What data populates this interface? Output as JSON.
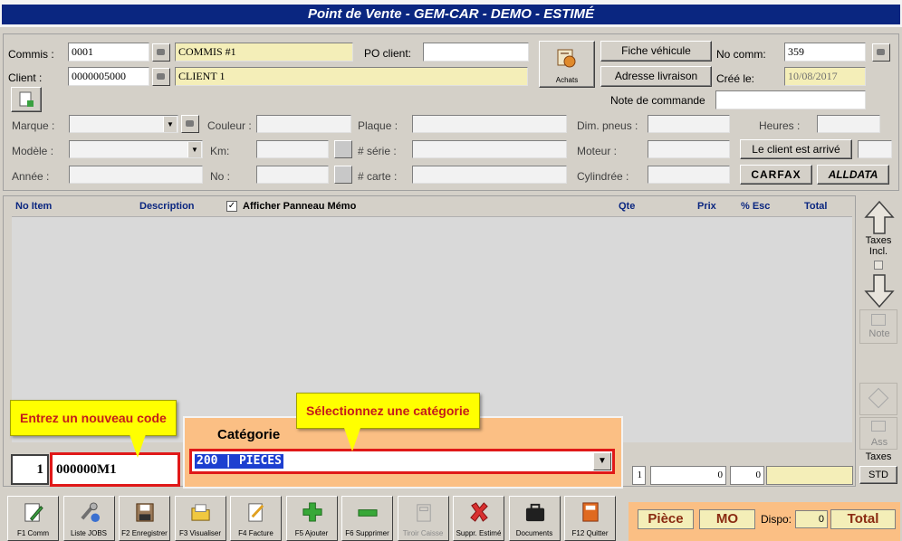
{
  "window": {
    "title": "Point de Vente - GEM-CAR - DEMO - ESTIMÉ"
  },
  "header": {
    "commis_label": "Commis :",
    "commis_code": "0001",
    "commis_name": "COMMIS #1",
    "client_label": "Client :",
    "client_code": "0000005000",
    "client_name": "CLIENT 1",
    "po_label": "PO client:",
    "po_value": "",
    "achats_label": "Achats",
    "fiche_vehicule": "Fiche véhicule",
    "adresse_livraison": "Adresse livraison",
    "no_comm_label": "No comm:",
    "no_comm_value": "359",
    "cree_le_label": "Créé le:",
    "cree_le_value": "10/08/2017",
    "note_commande_label": "Note de commande",
    "note_commande_value": ""
  },
  "vehicle": {
    "marque_label": "Marque :",
    "couleur_label": "Couleur :",
    "plaque_label": "Plaque :",
    "dim_pneus_label": "Dim. pneus :",
    "heures_label": "Heures :",
    "modele_label": "Modèle :",
    "km_label": "Km:",
    "serie_label": "# série :",
    "moteur_label": "Moteur :",
    "client_arrive": "Le client est arrivé",
    "annee_label": "Année :",
    "no_label": "No :",
    "carte_label": "# carte :",
    "cylindree_label": "Cylindrée :",
    "carfax_logo": "CARFAX",
    "alldata_logo": "ALLDATA"
  },
  "grid": {
    "col_no_item": "No Item",
    "col_description": "Description",
    "memo_checkbox_label": "Afficher Panneau Mémo",
    "memo_checked": true,
    "col_qte": "Qte",
    "col_prix": "Prix",
    "col_esc": "% Esc",
    "col_total": "Total"
  },
  "sidebar": {
    "taxes_incl_label": "Taxes Incl.",
    "note_label": "Note",
    "ass_label": "Ass",
    "taxes_label": "Taxes",
    "std_label": "STD"
  },
  "entry": {
    "qty": "1",
    "code": "000000M1",
    "categorie_label": "Catégorie",
    "categorie_value": "200 | PIECES"
  },
  "callouts": {
    "code": "Entrez un nouveau code",
    "categorie": "Sélectionnez une catégorie"
  },
  "totals_row": {
    "qty": "1",
    "v1": "0",
    "v2": "0"
  },
  "toolbar": [
    {
      "label": "F1 Comm",
      "icon": "pen-icon",
      "enabled": true
    },
    {
      "label": "Liste JOBS",
      "icon": "tools-icon",
      "enabled": true
    },
    {
      "label": "F2 Enregistrer",
      "icon": "floppy-icon",
      "enabled": true
    },
    {
      "label": "F3 Visualiser",
      "icon": "folder-icon",
      "enabled": true
    },
    {
      "label": "F4 Facture",
      "icon": "invoice-icon",
      "enabled": true
    },
    {
      "label": "F5 Ajouter",
      "icon": "plus-icon",
      "enabled": true
    },
    {
      "label": "F6 Supprimer",
      "icon": "minus-icon",
      "enabled": true
    },
    {
      "label": "Tiroir Caisse",
      "icon": "drawer-icon",
      "enabled": false
    },
    {
      "label": "Suppr. Estimé",
      "icon": "x-icon",
      "enabled": true
    },
    {
      "label": "Documents",
      "icon": "briefcase-icon",
      "enabled": true
    },
    {
      "label": "F12 Quitter",
      "icon": "exit-icon",
      "enabled": true
    }
  ],
  "bottom": {
    "piece": "Pièce",
    "mo": "MO",
    "dispo_label": "Dispo:",
    "dispo_value": "0",
    "total": "Total"
  },
  "colors": {
    "title_bg": "#0a2680",
    "callout_bg": "#ffff00",
    "callout_text": "#c41b1b",
    "highlight_border": "#e01818",
    "panel_orange": "#fbbf84"
  }
}
